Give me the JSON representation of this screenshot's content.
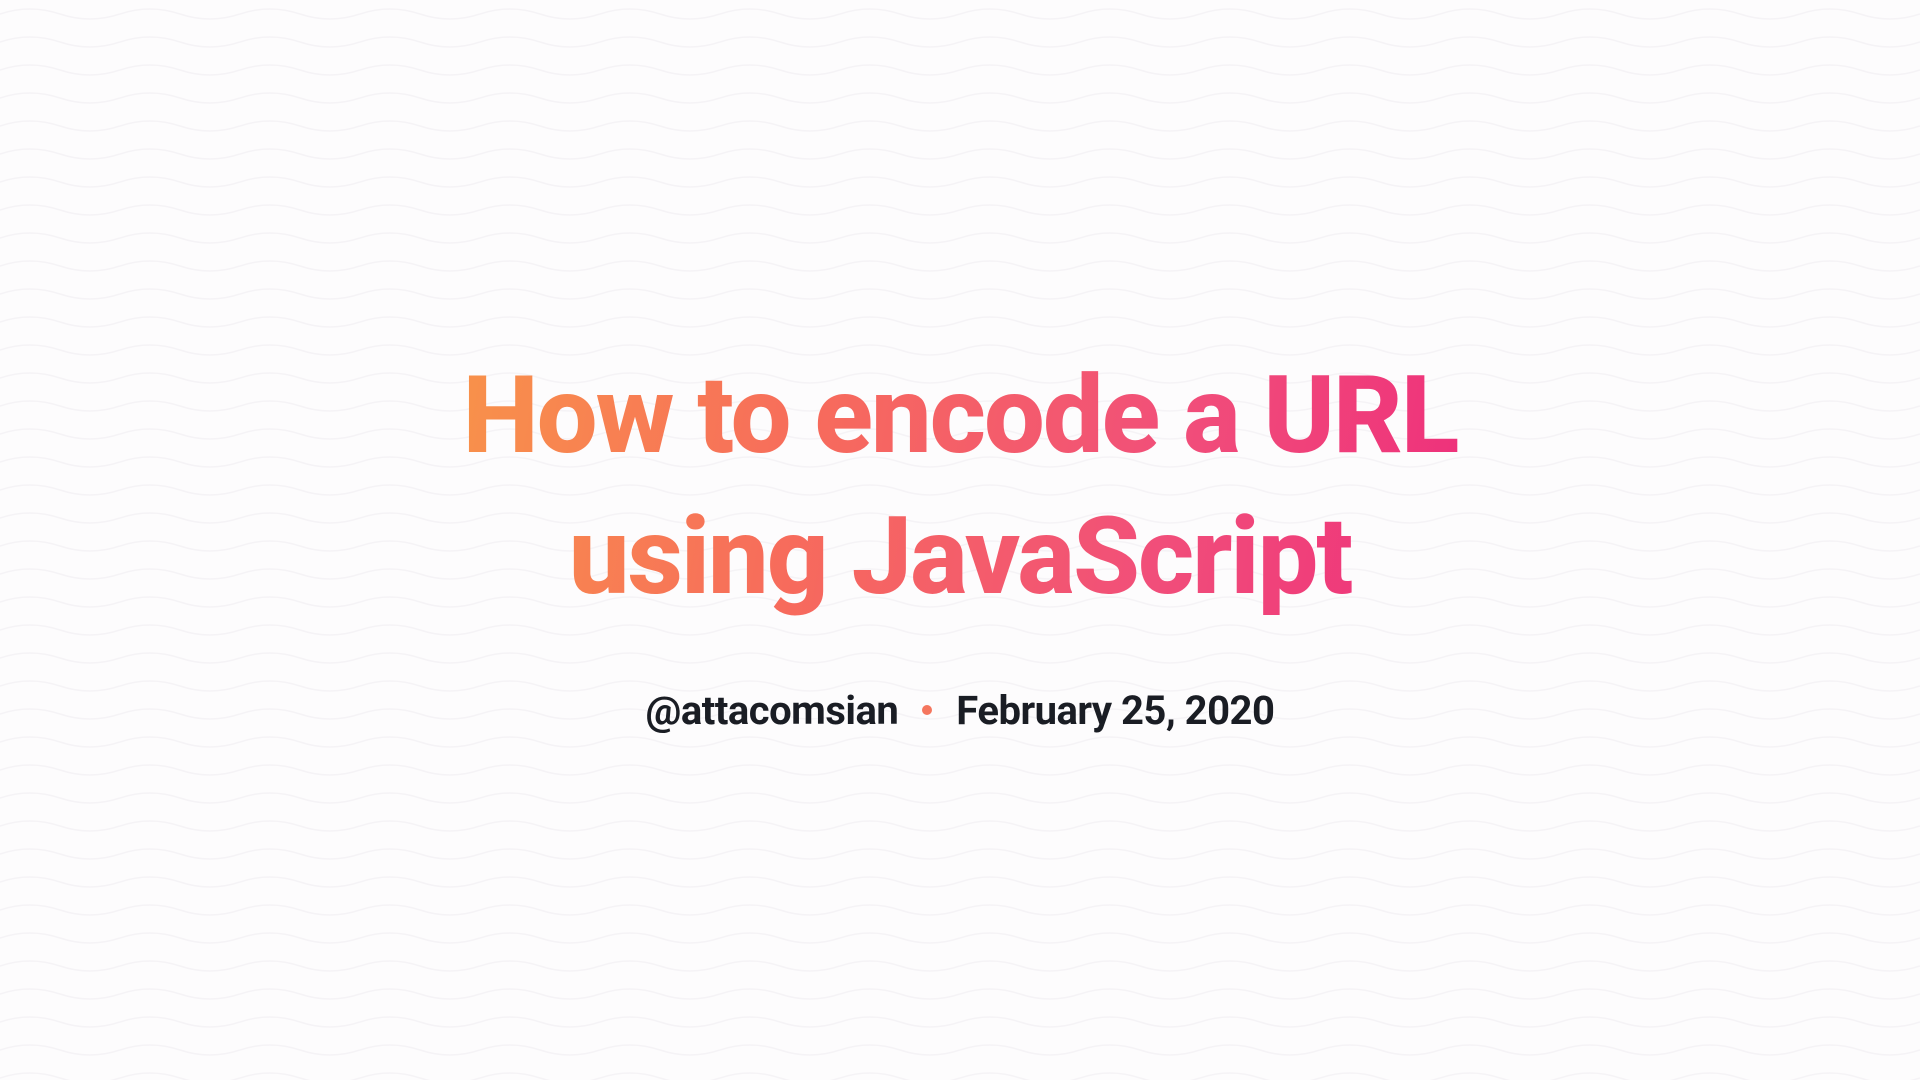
{
  "card": {
    "title": "How to encode a URL using JavaScript",
    "author": "@attacomsian",
    "date": "February 25, 2020"
  },
  "colors": {
    "gradient_start": "#f8924a",
    "gradient_mid1": "#f76b5c",
    "gradient_mid2": "#f14e7a",
    "gradient_end": "#ee2f7b",
    "bullet": "#f5765e",
    "text": "#1a1d24",
    "background": "#fdfcfd"
  }
}
